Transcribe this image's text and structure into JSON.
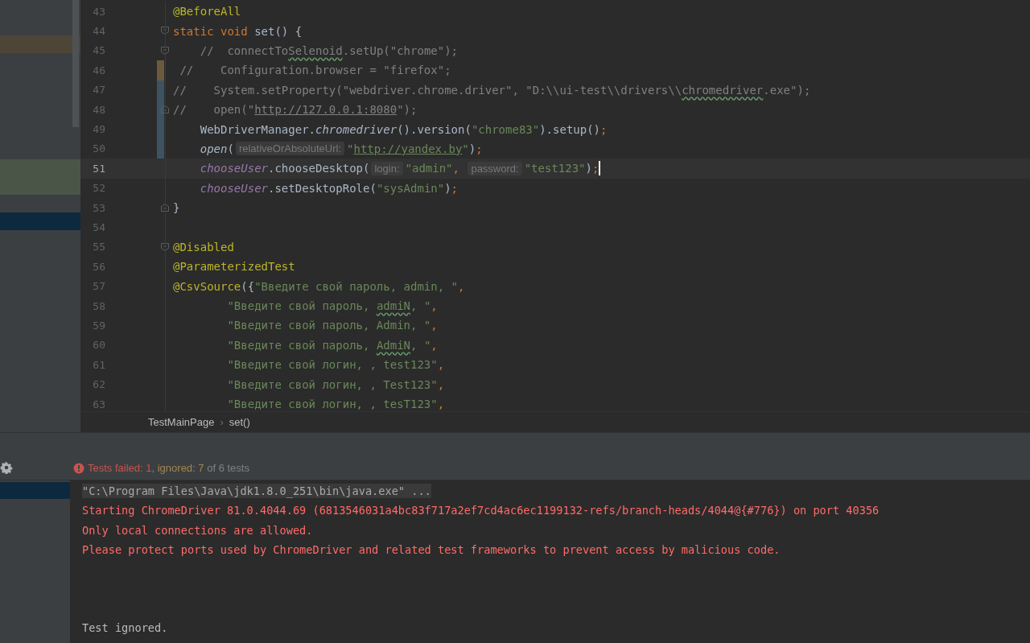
{
  "left_panel": {
    "rows": [
      {
        "kind": "plain"
      },
      {
        "kind": "plain"
      },
      {
        "kind": "modified"
      },
      {
        "kind": "plain"
      },
      {
        "kind": "plain"
      },
      {
        "kind": "plain"
      },
      {
        "kind": "plain"
      },
      {
        "kind": "plain"
      },
      {
        "kind": "plain"
      },
      {
        "kind": "added"
      },
      {
        "kind": "added"
      },
      {
        "kind": "plain"
      },
      {
        "kind": "selected"
      }
    ]
  },
  "editor": {
    "lines": [
      {
        "number": "43",
        "current": false,
        "fold_start": false,
        "fold_end": false,
        "modified": false,
        "changed": false,
        "tokens": [
          {
            "kind": "ann",
            "text": "@BeforeAll"
          }
        ]
      },
      {
        "number": "44",
        "current": false,
        "fold_start": true,
        "fold_end": false,
        "modified": false,
        "changed": false,
        "tokens": [
          {
            "kind": "kw",
            "text": "static void "
          },
          {
            "kind": "plain",
            "text": "set() {"
          }
        ]
      },
      {
        "number": "45",
        "current": false,
        "fold_start": true,
        "fold_end": false,
        "modified": false,
        "changed": false,
        "tokens": [
          {
            "kind": "comment",
            "text": "    //  connectTo"
          },
          {
            "kind": "comment-typo",
            "text": "Selenoid"
          },
          {
            "kind": "comment",
            "text": ".setUp(\"chrome\");"
          }
        ]
      },
      {
        "number": "46",
        "current": false,
        "fold_start": false,
        "fold_end": false,
        "modified": true,
        "changed": false,
        "tokens": [
          {
            "kind": "comment",
            "text": " //    Configuration.browser = \"firefox\";"
          }
        ]
      },
      {
        "number": "47",
        "current": false,
        "fold_start": false,
        "fold_end": false,
        "modified": false,
        "changed": true,
        "tokens": [
          {
            "kind": "comment",
            "text": "//    System.setProperty(\"webdriver.chrome.driver\", \"D:\\\\ui-test\\\\drivers\\\\"
          },
          {
            "kind": "comment-typo",
            "text": "chromedriver"
          },
          {
            "kind": "comment",
            "text": ".exe\");"
          }
        ]
      },
      {
        "number": "48",
        "current": false,
        "fold_start": false,
        "fold_end": true,
        "modified": false,
        "changed": true,
        "tokens": [
          {
            "kind": "comment",
            "text": "//    open(\""
          },
          {
            "kind": "comment-link",
            "text": "http://127.0.0.1:8080"
          },
          {
            "kind": "comment",
            "text": "\");"
          }
        ]
      },
      {
        "number": "49",
        "current": false,
        "fold_start": false,
        "fold_end": false,
        "modified": false,
        "changed": true,
        "tokens": [
          {
            "kind": "plain",
            "text": "    WebDriverManager."
          },
          {
            "kind": "italic",
            "text": "chromedriver"
          },
          {
            "kind": "plain",
            "text": "().version("
          },
          {
            "kind": "str",
            "text": "\"chrome83\""
          },
          {
            "kind": "plain",
            "text": ").setup()"
          },
          {
            "kind": "punct",
            "text": ";"
          }
        ]
      },
      {
        "number": "50",
        "current": false,
        "fold_start": false,
        "fold_end": false,
        "modified": false,
        "changed": true,
        "tokens": [
          {
            "kind": "italic",
            "text": "    open"
          },
          {
            "kind": "plain",
            "text": "("
          },
          {
            "kind": "hint",
            "text": "relativeOrAbsoluteUrl:"
          },
          {
            "kind": "str",
            "text": "\""
          },
          {
            "kind": "link",
            "text": "http://yandex.by"
          },
          {
            "kind": "str",
            "text": "\""
          },
          {
            "kind": "plain",
            "text": ")"
          },
          {
            "kind": "punct",
            "text": ";"
          }
        ]
      },
      {
        "number": "51",
        "current": true,
        "fold_start": false,
        "fold_end": false,
        "modified": false,
        "changed": false,
        "caret": true,
        "tokens": [
          {
            "kind": "field",
            "text": "    chooseUser"
          },
          {
            "kind": "plain",
            "text": ".chooseDesktop("
          },
          {
            "kind": "hint",
            "text": "login:"
          },
          {
            "kind": "str",
            "text": "\"admin\""
          },
          {
            "kind": "punct",
            "text": ", "
          },
          {
            "kind": "hint",
            "text": "password:"
          },
          {
            "kind": "str",
            "text": "\"test123\""
          },
          {
            "kind": "plain",
            "text": ")"
          },
          {
            "kind": "punct",
            "text": ";"
          }
        ]
      },
      {
        "number": "52",
        "current": false,
        "fold_start": false,
        "fold_end": false,
        "modified": false,
        "changed": false,
        "tokens": [
          {
            "kind": "field",
            "text": "    chooseUser"
          },
          {
            "kind": "plain",
            "text": ".setDesktopRole("
          },
          {
            "kind": "str",
            "text": "\"sysAdmin\""
          },
          {
            "kind": "plain",
            "text": ")"
          },
          {
            "kind": "punct",
            "text": ";"
          }
        ]
      },
      {
        "number": "53",
        "current": false,
        "fold_start": false,
        "fold_end": true,
        "modified": false,
        "changed": false,
        "tokens": [
          {
            "kind": "plain",
            "text": "}"
          }
        ]
      },
      {
        "number": "54",
        "current": false,
        "fold_start": false,
        "fold_end": false,
        "modified": false,
        "changed": false
      },
      {
        "number": "55",
        "current": false,
        "fold_start": true,
        "fold_end": false,
        "modified": false,
        "changed": false,
        "tokens": [
          {
            "kind": "ann",
            "text": "@Disabled"
          }
        ]
      },
      {
        "number": "56",
        "current": false,
        "fold_start": false,
        "fold_end": false,
        "modified": false,
        "changed": false,
        "tokens": [
          {
            "kind": "ann",
            "text": "@ParameterizedTest"
          }
        ]
      },
      {
        "number": "57",
        "current": false,
        "fold_start": false,
        "fold_end": false,
        "modified": false,
        "changed": false,
        "tokens": [
          {
            "kind": "ann",
            "text": "@CsvSource"
          },
          {
            "kind": "plain",
            "text": "({"
          },
          {
            "kind": "str",
            "text": "\"Введите свой пароль, admin, \""
          },
          {
            "kind": "punct",
            "text": ","
          }
        ]
      },
      {
        "number": "58",
        "current": false,
        "fold_start": false,
        "fold_end": false,
        "modified": false,
        "changed": false,
        "tokens": [
          {
            "kind": "str",
            "text": "        \"Введите свой пароль, "
          },
          {
            "kind": "str-typo",
            "text": "admiN"
          },
          {
            "kind": "str",
            "text": ", \""
          },
          {
            "kind": "punct",
            "text": ","
          }
        ]
      },
      {
        "number": "59",
        "current": false,
        "fold_start": false,
        "fold_end": false,
        "modified": false,
        "changed": false,
        "tokens": [
          {
            "kind": "str",
            "text": "        \"Введите свой пароль, Admin, \""
          },
          {
            "kind": "punct",
            "text": ","
          }
        ]
      },
      {
        "number": "60",
        "current": false,
        "fold_start": false,
        "fold_end": false,
        "modified": false,
        "changed": false,
        "tokens": [
          {
            "kind": "str",
            "text": "        \"Введите свой пароль, "
          },
          {
            "kind": "str-typo",
            "text": "AdmiN"
          },
          {
            "kind": "str",
            "text": ", \""
          },
          {
            "kind": "punct",
            "text": ","
          }
        ]
      },
      {
        "number": "61",
        "current": false,
        "fold_start": false,
        "fold_end": false,
        "modified": false,
        "changed": false,
        "tokens": [
          {
            "kind": "str",
            "text": "        \"Введите свой логин, , test123\""
          },
          {
            "kind": "punct",
            "text": ","
          }
        ]
      },
      {
        "number": "62",
        "current": false,
        "fold_start": false,
        "fold_end": false,
        "modified": false,
        "changed": false,
        "tokens": [
          {
            "kind": "str",
            "text": "        \"Введите свой логин, , Test123\""
          },
          {
            "kind": "punct",
            "text": ","
          }
        ]
      },
      {
        "number": "63",
        "current": false,
        "fold_start": false,
        "fold_end": false,
        "modified": false,
        "changed": false,
        "tokens": [
          {
            "kind": "str",
            "text": "        \"Введите свой логин, , tesT123\""
          },
          {
            "kind": "punct",
            "text": ","
          }
        ]
      }
    ]
  },
  "breadcrumbs": [
    {
      "text": "TestMainPage"
    },
    {
      "text": "set()"
    }
  ],
  "breadcrumb_separator": "›",
  "run_panel": {
    "status": [
      {
        "kind": "failed",
        "text": "Tests failed: 1"
      },
      {
        "kind": "plain",
        "text": ", "
      },
      {
        "kind": "ignored",
        "text": "ignored: 7"
      },
      {
        "kind": "plain",
        "text": " of 6 tests"
      }
    ],
    "tree_rows": [
      {
        "selected": true
      }
    ],
    "console": [
      {
        "kind": "command",
        "text": "\"C:\\Program Files\\Java\\jdk1.8.0_251\\bin\\java.exe\" ..."
      },
      {
        "kind": "error",
        "text": "Starting ChromeDriver 81.0.4044.69 (6813546031a4bc83f717a2ef7cd4ac6ec1199132-refs/branch-heads/4044@{#776}) on port 40356"
      },
      {
        "kind": "error",
        "text": "Only local connections are allowed."
      },
      {
        "kind": "error",
        "text": "Please protect ports used by ChromeDriver and related test frameworks to prevent access by malicious code."
      },
      {
        "kind": "blank"
      },
      {
        "kind": "blank"
      },
      {
        "kind": "blank"
      },
      {
        "kind": "info",
        "text": "Test ignored."
      }
    ]
  }
}
